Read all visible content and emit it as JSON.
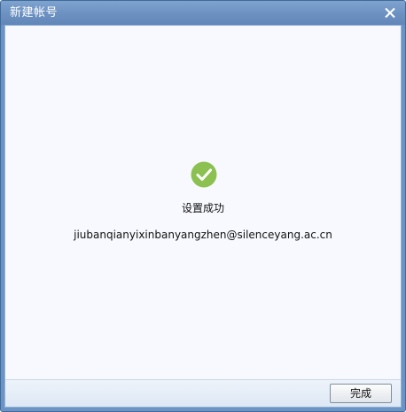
{
  "window": {
    "title": "新建帐号"
  },
  "result": {
    "status_text": "设置成功",
    "account": "jiubanqianyixinbanyangzhen@silenceyang.ac.cn",
    "icon": "checkmark-circle-icon"
  },
  "footer": {
    "finish_label": "完成"
  },
  "colors": {
    "titlebar": "#6c91c1",
    "success_green": "#8cc152",
    "content_bg": "#f8f9fe"
  }
}
